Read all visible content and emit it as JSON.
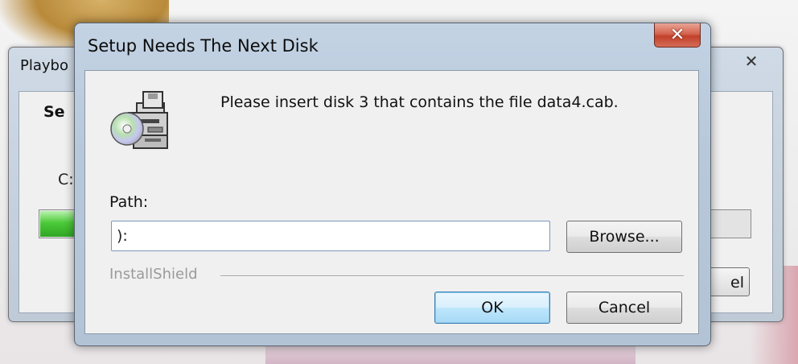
{
  "background_window": {
    "title": "Playbo",
    "heading": "Se",
    "text": "C:",
    "button_label": "el",
    "close_glyph": "✕",
    "progress_fraction": 0.95
  },
  "dialog": {
    "title": "Setup Needs The Next Disk",
    "close_glyph": "✕",
    "icon": "disk-drive-icon",
    "message": "Please insert disk 3 that contains the file data4.cab.",
    "path_label": "Path:",
    "path_value": "):",
    "browse_label": "Browse...",
    "brand": "InstallShield",
    "ok_label": "OK",
    "cancel_label": "Cancel"
  },
  "colors": {
    "title_bar": "#b7c8da",
    "close_button": "#c1402a",
    "default_button_border": "#3c7fb1",
    "progress_green": "#4dca3a"
  }
}
